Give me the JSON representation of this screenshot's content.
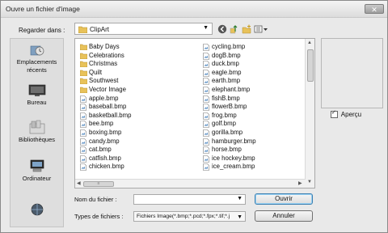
{
  "window": {
    "title": "Ouvre un fichier d'image",
    "close_glyph": "✕"
  },
  "lookin": {
    "label": "Regarder dans :",
    "value": "ClipArt"
  },
  "places": [
    {
      "label": "Emplacements récents",
      "icon": "recent-places-icon"
    },
    {
      "label": "Bureau",
      "icon": "desktop-icon"
    },
    {
      "label": "Bibliothèques",
      "icon": "libraries-icon"
    },
    {
      "label": "Ordinateur",
      "icon": "computer-icon"
    },
    {
      "label": "",
      "icon": "network-icon"
    }
  ],
  "files": {
    "column1": [
      "Baby Days",
      "Celebrations",
      "Christmas",
      "Quilt",
      "Southwest",
      "Vector Image",
      "apple.bmp",
      "baseball.bmp",
      "basketball.bmp",
      "bee.bmp",
      "boxing.bmp",
      "candy.bmp",
      "cat.bmp",
      "catfish.bmp",
      "chicken.bmp"
    ],
    "column2": [
      "cycling.bmp",
      "dogB.bmp",
      "duck.bmp",
      "eagle.bmp",
      "earth.bmp",
      "elephant.bmp",
      "fishB.bmp",
      "flowerB.bmp",
      "frog.bmp",
      "golf.bmp",
      "gorilla.bmp",
      "hamburger.bmp",
      "horse.bmp",
      "ice hockey.bmp",
      "ice_cream.bmp"
    ],
    "folder_count": 6
  },
  "preview_checkbox": {
    "label": "Aperçu",
    "checked": true
  },
  "filename": {
    "label": "Nom du fichier :",
    "value": ""
  },
  "filetype": {
    "label": "Types de fichiers :",
    "value": "Fichiers Image(*.bmp;*.pcd;*.fpx;*.tif;*.j"
  },
  "buttons": {
    "open": "Ouvrir",
    "cancel": "Annuler"
  },
  "hscroll_grip": "≡",
  "colors": {
    "folder": "#e8c25a",
    "window_bg": "#e9e9e9",
    "accent": "#3c7fb1"
  }
}
